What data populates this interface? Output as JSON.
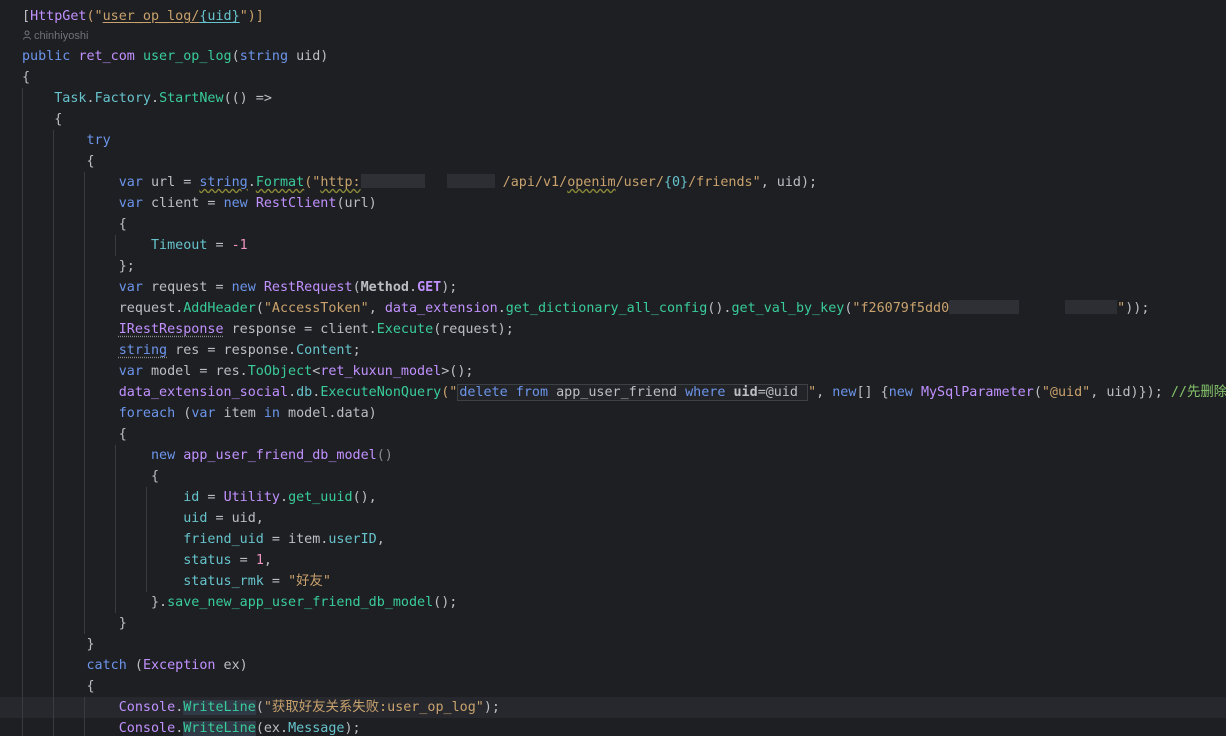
{
  "author": {
    "name": "chinhiyoshi"
  },
  "code": {
    "attribute": {
      "open": "[",
      "name": "HttpGet",
      "paren_open": "(\"",
      "route_a": "user_op_log/",
      "route_b": "{uid}",
      "paren_close": "\")]"
    },
    "sig": {
      "public": "public",
      "ret": "ret_com",
      "name": "user_op_log",
      "paren": "(",
      "string": "string",
      "param": " uid)"
    },
    "brace_open": "{",
    "brace_close": "}",
    "task": {
      "task": "Task",
      "dot1": ".",
      "factory": "Factory",
      "dot2": ".",
      "startnew": "StartNew",
      "rest": "(() =>"
    },
    "try": "try",
    "url": {
      "var": "var",
      "name": " url = ",
      "string": "string",
      "dot": ".",
      "format": "Format",
      "open": "(\"",
      "http": "http:",
      "path_a": " /api/v1/",
      "openim": "openim",
      "path_b": "/user/",
      "ph": "{0}",
      "path_c": "/friends\"",
      "tail": ", uid);"
    },
    "client": {
      "var": "var",
      "name": " client = ",
      "new": "new",
      "cls": "RestClient",
      "tail": "(url)"
    },
    "timeout": {
      "prop": "Timeout",
      "eq": " = ",
      "num": "-1"
    },
    "client_end": "};",
    "request": {
      "var": "var",
      "name": " request = ",
      "new": "new",
      "cls": "RestRequest",
      "open": "(",
      "method": "Method",
      "dot": ".",
      "get": "GET",
      "tail": ");"
    },
    "header": {
      "obj": "request",
      "dot": ".",
      "meth": "AddHeader",
      "open": "(",
      "s1": "\"AccessToken\"",
      "comma": ", ",
      "ext": "data_extension",
      "dot2": ".",
      "m2": "get_dictionary_all_config",
      "p2": "().",
      "m3": "get_val_by_key",
      "open3": "(",
      "s2": "\"f26079f5dd0",
      "s2end": "\"",
      "tail": "));"
    },
    "response": {
      "iface": "IRestResponse",
      "name": " response = client.",
      "meth": "Execute",
      "tail": "(request);"
    },
    "res": {
      "string": "string",
      "name": " res = response.",
      "prop": "Content",
      "tail": ";"
    },
    "model": {
      "var": "var",
      "name": " model = res.",
      "meth": "ToObject",
      "lt": "<",
      "cls": "ret_kuxun_model",
      "tail": ">();"
    },
    "exec": {
      "ext": "data_extension_social",
      "dot": ".",
      "db": "db",
      "dot2": ".",
      "meth": "ExecuteNonQuery",
      "open": "(\"",
      "sql_delete": "delete",
      "sql_from": " from ",
      "sql_table": "app_user_friend",
      "sql_where": " where ",
      "sql_col": "uid",
      "sql_eq": "=@uid ",
      "close": "\"",
      "comma": ", ",
      "new1": "new",
      "arr": "[] {",
      "new2": "new",
      "cls": "MySqlParameter",
      "popen": "(",
      "ps": "\"@uid\"",
      "ptail": ", uid)}); ",
      "comment": "//先删除"
    },
    "foreach": {
      "kw": "foreach",
      "open": " (",
      "var": "var",
      "item": " item ",
      "in": "in",
      "tail": " model.data)"
    },
    "newmodel": {
      "new": "new",
      "cls": " app_user_friend_db_model",
      "parens": "()"
    },
    "fields": [
      {
        "name": "id",
        "eq": " = ",
        "val_a": "Utility",
        "val_b": ".",
        "val_c": "get_uuid",
        "val_d": "(),"
      },
      {
        "name": "uid",
        "eq": " = ",
        "val": "uid,"
      },
      {
        "name": "friend_uid",
        "eq": " = ",
        "val_a": "item.",
        "val_b": "userID",
        "val_c": ","
      },
      {
        "name": "status",
        "eq": " = ",
        "num": "1",
        "tail": ","
      },
      {
        "name": "status_rmk",
        "eq": " = ",
        "str": "\"好友\""
      }
    ],
    "save": {
      "open": "}.",
      "meth": "save_new_app_user_friend_db_model",
      "tail": "();"
    },
    "catch": {
      "kw": "catch",
      "open": " (",
      "cls": "Exception",
      "tail": " ex)"
    },
    "console1": {
      "cls": "Console",
      "dot": ".",
      "meth": "WriteLine",
      "open": "(",
      "str": "\"获取好友关系失败:user_op_log\"",
      "tail": ");"
    },
    "console2": {
      "cls": "Console",
      "dot": ".",
      "meth": "WriteLine",
      "open": "(ex.",
      "prop": "Message",
      "tail": ");"
    }
  },
  "colors": {
    "background": "#1e1f22",
    "keyword": "#6c95eb",
    "class": "#c191ff",
    "method": "#39cc9b",
    "string": "#c9a26d",
    "number": "#ed94c0",
    "comment": "#85c46c"
  }
}
